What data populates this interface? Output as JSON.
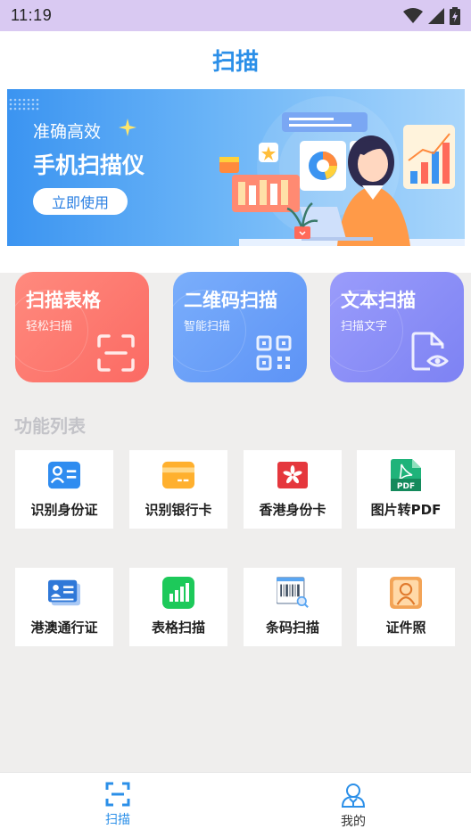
{
  "status_bar": {
    "time": "11:19"
  },
  "header": {
    "title": "扫描"
  },
  "banner": {
    "subtitle": "准确高效",
    "title": "手机扫描仪",
    "button_label": "立即使用"
  },
  "feature_cards": [
    {
      "title": "扫描表格",
      "subtitle": "轻松扫描",
      "icon": "scan-frame-icon",
      "color": "#fb6a63"
    },
    {
      "title": "二维码扫描",
      "subtitle": "智能扫描",
      "icon": "qr-code-icon",
      "color": "#5d93f6"
    },
    {
      "title": "文本扫描",
      "subtitle": "扫描文字",
      "icon": "document-eye-icon",
      "color": "#7d82f3"
    }
  ],
  "section": {
    "title": "功能列表"
  },
  "functions": [
    {
      "label": "识别身份证",
      "icon": "id-card-icon"
    },
    {
      "label": "识别银行卡",
      "icon": "bank-card-icon"
    },
    {
      "label": "香港身份卡",
      "icon": "hk-id-icon"
    },
    {
      "label": "图片转PDF",
      "icon": "pdf-icon"
    },
    {
      "label": "港澳通行证",
      "icon": "pass-permit-icon"
    },
    {
      "label": "表格扫描",
      "icon": "table-chart-icon"
    },
    {
      "label": "条码扫描",
      "icon": "barcode-icon"
    },
    {
      "label": "证件照",
      "icon": "id-photo-icon"
    }
  ],
  "tab_bar": {
    "items": [
      {
        "label": "扫描",
        "icon": "scan-icon",
        "active": true
      },
      {
        "label": "我的",
        "icon": "profile-icon",
        "active": false
      }
    ]
  },
  "colors": {
    "accent": "#2b8fe8",
    "status_bar": "#d9c9f2"
  }
}
